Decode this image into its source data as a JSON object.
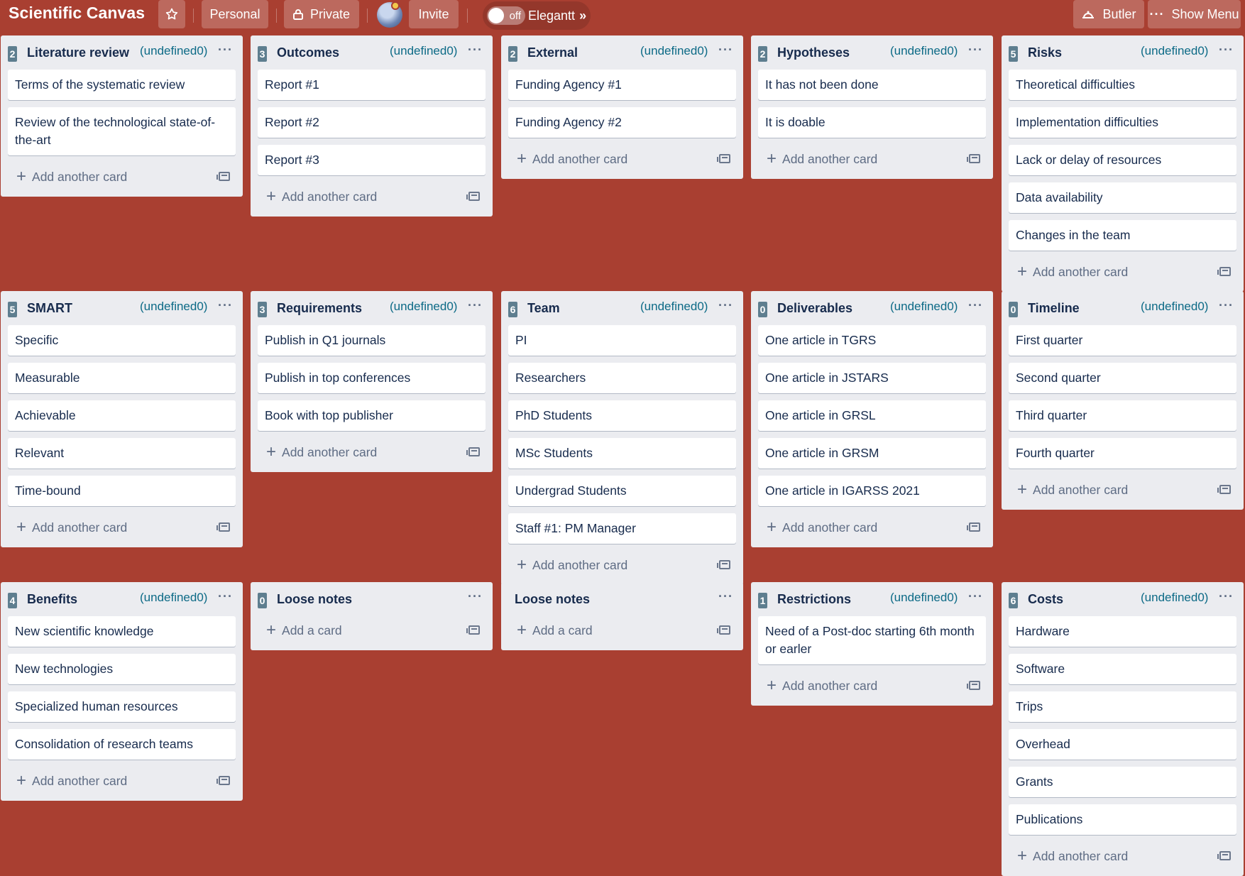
{
  "header": {
    "board_title": "Scientific Canvas",
    "personal_label": "Personal",
    "private_label": "Private",
    "invite_label": "Invite",
    "elegantt_toggle": "off",
    "elegantt_label": "Elegantt",
    "butler_label": "Butler",
    "show_menu_label": "Show Menu"
  },
  "lists": [
    {
      "count": "2",
      "title": "Literature review",
      "meta": "(undefined0)",
      "cards": [
        "Terms of the systematic review",
        "Review of the technological state-of-the-art"
      ],
      "add_label": "Add another card"
    },
    {
      "count": "3",
      "title": "Outcomes",
      "meta": "(undefined0)",
      "cards": [
        "Report #1",
        "Report #2",
        "Report #3"
      ],
      "add_label": "Add another card"
    },
    {
      "count": "2",
      "title": "External",
      "meta": "(undefined0)",
      "cards": [
        "Funding Agency #1",
        "Funding Agency #2"
      ],
      "add_label": "Add another card"
    },
    {
      "count": "2",
      "title": "Hypotheses",
      "meta": "(undefined0)",
      "cards": [
        "It has not been done",
        "It is doable"
      ],
      "add_label": "Add another card"
    },
    {
      "count": "5",
      "title": "Risks",
      "meta": "(undefined0)",
      "cards": [
        "Theoretical difficulties",
        "Implementation difficulties",
        "Lack or delay of resources",
        "Data availability",
        "Changes in the team"
      ],
      "add_label": "Add another card"
    },
    {
      "count": "5",
      "title": "SMART",
      "meta": "(undefined0)",
      "cards": [
        "Specific",
        "Measurable",
        "Achievable",
        "Relevant",
        "Time-bound"
      ],
      "add_label": "Add another card"
    },
    {
      "count": "3",
      "title": "Requirements",
      "meta": "(undefined0)",
      "cards": [
        "Publish in Q1 journals",
        "Publish in top conferences",
        "Book with top publisher"
      ],
      "add_label": "Add another card"
    },
    {
      "count": "6",
      "title": "Team",
      "meta": "(undefined0)",
      "cards": [
        "PI",
        "Researchers",
        "PhD Students",
        "MSc Students",
        "Undergrad Students",
        "Staff #1: PM Manager"
      ],
      "add_label": "Add another card"
    },
    {
      "count": "0",
      "title": "Deliverables",
      "meta": "(undefined0)",
      "cards": [
        "One article in TGRS",
        "One article in JSTARS",
        "One article in GRSL",
        "One article in GRSM",
        "One article in IGARSS 2021"
      ],
      "add_label": "Add another card"
    },
    {
      "count": "0",
      "title": "Timeline",
      "meta": "(undefined0)",
      "cards": [
        "First quarter",
        "Second quarter",
        "Third quarter",
        "Fourth quarter"
      ],
      "add_label": "Add another card"
    },
    {
      "count": "4",
      "title": "Benefits",
      "meta": "(undefined0)",
      "cards": [
        "New scientific knowledge",
        "New technologies",
        "Specialized human resources",
        "Consolidation of research teams"
      ],
      "add_label": "Add another card"
    },
    {
      "count": "0",
      "title": "Loose notes",
      "meta": "",
      "cards": [],
      "add_label": "Add a card"
    },
    {
      "count": "",
      "title": "Loose notes",
      "meta": "",
      "cards": [],
      "add_label": "Add a card"
    },
    {
      "count": "1",
      "title": "Restrictions",
      "meta": "(undefined0)",
      "cards": [
        "Need of a Post-doc starting 6th month or earler"
      ],
      "add_label": "Add another card"
    },
    {
      "count": "6",
      "title": "Costs",
      "meta": "(undefined0)",
      "cards": [
        "Hardware",
        "Software",
        "Trips",
        "Overhead",
        "Grants",
        "Publications"
      ],
      "add_label": "Add another card"
    }
  ]
}
